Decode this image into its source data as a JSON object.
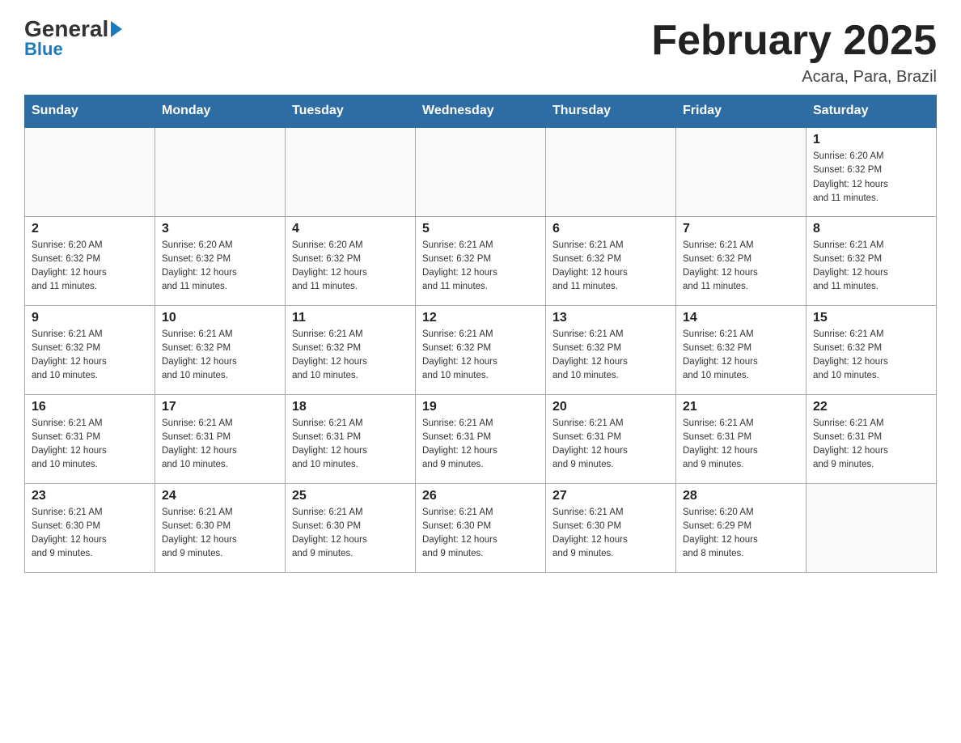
{
  "logo": {
    "general": "General",
    "blue": "Blue"
  },
  "header": {
    "title": "February 2025",
    "location": "Acara, Para, Brazil"
  },
  "weekdays": [
    "Sunday",
    "Monday",
    "Tuesday",
    "Wednesday",
    "Thursday",
    "Friday",
    "Saturday"
  ],
  "weeks": [
    [
      {
        "day": "",
        "info": ""
      },
      {
        "day": "",
        "info": ""
      },
      {
        "day": "",
        "info": ""
      },
      {
        "day": "",
        "info": ""
      },
      {
        "day": "",
        "info": ""
      },
      {
        "day": "",
        "info": ""
      },
      {
        "day": "1",
        "info": "Sunrise: 6:20 AM\nSunset: 6:32 PM\nDaylight: 12 hours\nand 11 minutes."
      }
    ],
    [
      {
        "day": "2",
        "info": "Sunrise: 6:20 AM\nSunset: 6:32 PM\nDaylight: 12 hours\nand 11 minutes."
      },
      {
        "day": "3",
        "info": "Sunrise: 6:20 AM\nSunset: 6:32 PM\nDaylight: 12 hours\nand 11 minutes."
      },
      {
        "day": "4",
        "info": "Sunrise: 6:20 AM\nSunset: 6:32 PM\nDaylight: 12 hours\nand 11 minutes."
      },
      {
        "day": "5",
        "info": "Sunrise: 6:21 AM\nSunset: 6:32 PM\nDaylight: 12 hours\nand 11 minutes."
      },
      {
        "day": "6",
        "info": "Sunrise: 6:21 AM\nSunset: 6:32 PM\nDaylight: 12 hours\nand 11 minutes."
      },
      {
        "day": "7",
        "info": "Sunrise: 6:21 AM\nSunset: 6:32 PM\nDaylight: 12 hours\nand 11 minutes."
      },
      {
        "day": "8",
        "info": "Sunrise: 6:21 AM\nSunset: 6:32 PM\nDaylight: 12 hours\nand 11 minutes."
      }
    ],
    [
      {
        "day": "9",
        "info": "Sunrise: 6:21 AM\nSunset: 6:32 PM\nDaylight: 12 hours\nand 10 minutes."
      },
      {
        "day": "10",
        "info": "Sunrise: 6:21 AM\nSunset: 6:32 PM\nDaylight: 12 hours\nand 10 minutes."
      },
      {
        "day": "11",
        "info": "Sunrise: 6:21 AM\nSunset: 6:32 PM\nDaylight: 12 hours\nand 10 minutes."
      },
      {
        "day": "12",
        "info": "Sunrise: 6:21 AM\nSunset: 6:32 PM\nDaylight: 12 hours\nand 10 minutes."
      },
      {
        "day": "13",
        "info": "Sunrise: 6:21 AM\nSunset: 6:32 PM\nDaylight: 12 hours\nand 10 minutes."
      },
      {
        "day": "14",
        "info": "Sunrise: 6:21 AM\nSunset: 6:32 PM\nDaylight: 12 hours\nand 10 minutes."
      },
      {
        "day": "15",
        "info": "Sunrise: 6:21 AM\nSunset: 6:32 PM\nDaylight: 12 hours\nand 10 minutes."
      }
    ],
    [
      {
        "day": "16",
        "info": "Sunrise: 6:21 AM\nSunset: 6:31 PM\nDaylight: 12 hours\nand 10 minutes."
      },
      {
        "day": "17",
        "info": "Sunrise: 6:21 AM\nSunset: 6:31 PM\nDaylight: 12 hours\nand 10 minutes."
      },
      {
        "day": "18",
        "info": "Sunrise: 6:21 AM\nSunset: 6:31 PM\nDaylight: 12 hours\nand 10 minutes."
      },
      {
        "day": "19",
        "info": "Sunrise: 6:21 AM\nSunset: 6:31 PM\nDaylight: 12 hours\nand 9 minutes."
      },
      {
        "day": "20",
        "info": "Sunrise: 6:21 AM\nSunset: 6:31 PM\nDaylight: 12 hours\nand 9 minutes."
      },
      {
        "day": "21",
        "info": "Sunrise: 6:21 AM\nSunset: 6:31 PM\nDaylight: 12 hours\nand 9 minutes."
      },
      {
        "day": "22",
        "info": "Sunrise: 6:21 AM\nSunset: 6:31 PM\nDaylight: 12 hours\nand 9 minutes."
      }
    ],
    [
      {
        "day": "23",
        "info": "Sunrise: 6:21 AM\nSunset: 6:30 PM\nDaylight: 12 hours\nand 9 minutes."
      },
      {
        "day": "24",
        "info": "Sunrise: 6:21 AM\nSunset: 6:30 PM\nDaylight: 12 hours\nand 9 minutes."
      },
      {
        "day": "25",
        "info": "Sunrise: 6:21 AM\nSunset: 6:30 PM\nDaylight: 12 hours\nand 9 minutes."
      },
      {
        "day": "26",
        "info": "Sunrise: 6:21 AM\nSunset: 6:30 PM\nDaylight: 12 hours\nand 9 minutes."
      },
      {
        "day": "27",
        "info": "Sunrise: 6:21 AM\nSunset: 6:30 PM\nDaylight: 12 hours\nand 9 minutes."
      },
      {
        "day": "28",
        "info": "Sunrise: 6:20 AM\nSunset: 6:29 PM\nDaylight: 12 hours\nand 8 minutes."
      },
      {
        "day": "",
        "info": ""
      }
    ]
  ]
}
